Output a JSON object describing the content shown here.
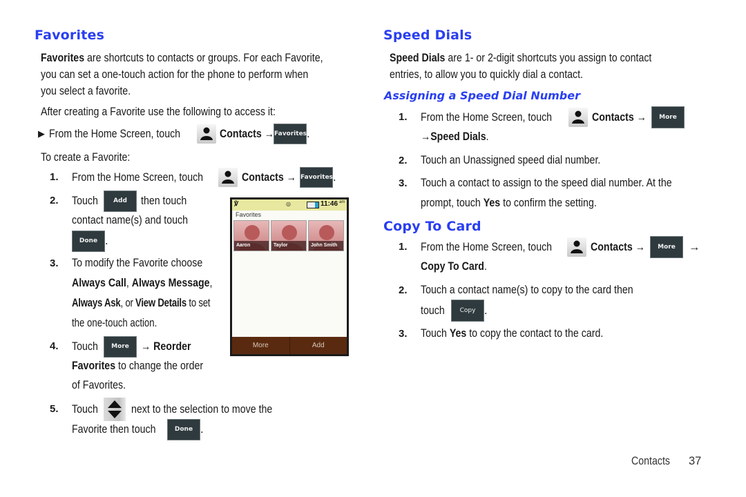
{
  "left": {
    "title": "Favorites",
    "intro_bold": "Favorites",
    "intro_rest": " are shortcuts to contacts or groups. For each Favorite,",
    "intro_line2": "you can set a one-touch action for the phone to perform when",
    "intro_line3": "you select a favorite.",
    "access_line": "After creating a Favorite use the following to access it:",
    "bullet": {
      "text": "From the Home Screen, touch",
      "contacts": "Contacts →",
      "button": "Favorites",
      "end": "."
    },
    "create_label": "To create a Favorite:",
    "steps": [
      {
        "num": "1.",
        "text": "From the Home Screen, touch",
        "contacts": "Contacts →",
        "button": "Favorites",
        "end": "."
      },
      {
        "num": "2.",
        "pre": "Touch",
        "button": "Add",
        "post": "then touch",
        "line2": "contact name(s) and touch",
        "button2": "Done",
        "end": "."
      },
      {
        "num": "3.",
        "line1": "To modify the Favorite choose",
        "b1": "Always Call",
        "sep1": ", ",
        "b2": "Always Message",
        "sep2": ",",
        "b3": "Always Ask",
        "sep3": ", or ",
        "b4": "View Details",
        "tail": " to set",
        "line4": "the one-touch action."
      },
      {
        "num": "4.",
        "pre": "Touch",
        "button": "More",
        "arrow_bold": "→ Reorder",
        "b2": "Favorites",
        "post": " to change the order",
        "line3": "of Favorites."
      },
      {
        "num": "5.",
        "pre": "Touch",
        "post": "next to the selection to move the",
        "line2": "Favorite then touch",
        "button": "Done",
        "end": "."
      }
    ]
  },
  "phone": {
    "status_time": "11:46",
    "status_ampm": "am",
    "section_label": "Favorites",
    "contacts": [
      "Aaron",
      "Taylor",
      "John Smith"
    ],
    "softkeys": [
      "More",
      "Add"
    ]
  },
  "right": {
    "title": "Speed Dials",
    "intro_bold": "Speed Dials",
    "intro_rest": " are 1- or 2-digit shortcuts you assign to contact",
    "intro_line2": "entries, to allow you to quickly dial a contact.",
    "subtitle": "Assigning a Speed Dial Number",
    "steps": [
      {
        "num": "1.",
        "text": "From the Home Screen, touch",
        "contacts": "Contacts →",
        "button": "More",
        "line2": "→Speed Dials",
        "end": "."
      },
      {
        "num": "2.",
        "text": "Touch an Unassigned speed dial number."
      },
      {
        "num": "3.",
        "text": "Touch a contact to assign to the speed dial number. At the",
        "line2_pre": "prompt, touch ",
        "line2_bold": "Yes",
        "line2_post": " to confirm the setting."
      }
    ],
    "copy_title": "Copy To Card",
    "copy_steps": [
      {
        "num": "1.",
        "text": "From the Home Screen, touch",
        "contacts": "Contacts →",
        "button": "More",
        "arrow": "→",
        "line2": "Copy To Card",
        "end": "."
      },
      {
        "num": "2.",
        "text": "Touch a contact name(s) to copy to the card then",
        "line2": "touch",
        "button": "Copy",
        "end": "."
      },
      {
        "num": "3.",
        "pre": "Touch ",
        "bold": "Yes",
        "post": " to copy the contact to the card."
      }
    ]
  },
  "footer": {
    "section": "Contacts",
    "page": "37"
  }
}
